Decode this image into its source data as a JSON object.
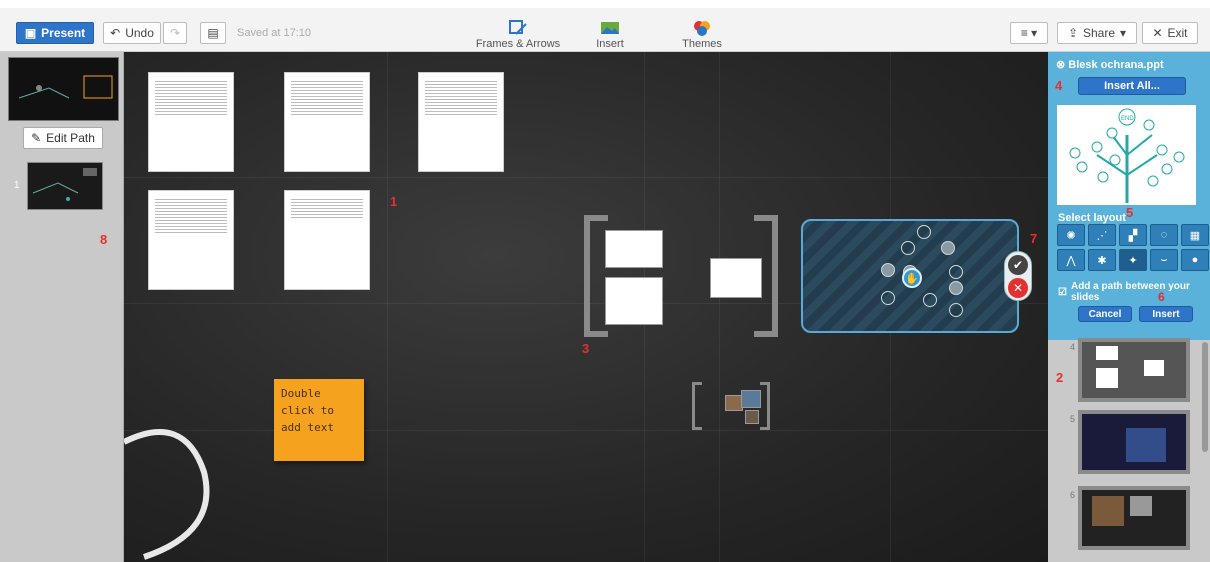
{
  "toolbar": {
    "present_label": "Present",
    "undo_label": "Undo",
    "saved_text": "Saved at 17:10",
    "frames_label": "Frames & Arrows",
    "insert_label": "Insert",
    "themes_label": "Themes",
    "share_label": "Share",
    "exit_label": "Exit"
  },
  "left_panel": {
    "edit_path_label": "Edit Path",
    "slide_number": "1"
  },
  "canvas": {
    "sticky_text": "Double click to add text"
  },
  "annotations": [
    "1",
    "2",
    "3",
    "4",
    "5",
    "6",
    "7",
    "8"
  ],
  "right_panel": {
    "title": "Blesk ochrana.ppt",
    "insert_all_label": "Insert All...",
    "select_layout_label": "Select layout",
    "add_path_label": "Add a path between your slides",
    "cancel_label": "Cancel",
    "insert_label": "Insert",
    "tree_end_label": "END",
    "thumb_numbers": [
      "4",
      "5",
      "6"
    ]
  },
  "colors": {
    "accent": "#2e74c9",
    "panel": "#5ab1d9",
    "annotation": "#e53030",
    "sticky": "#f5a31f"
  }
}
